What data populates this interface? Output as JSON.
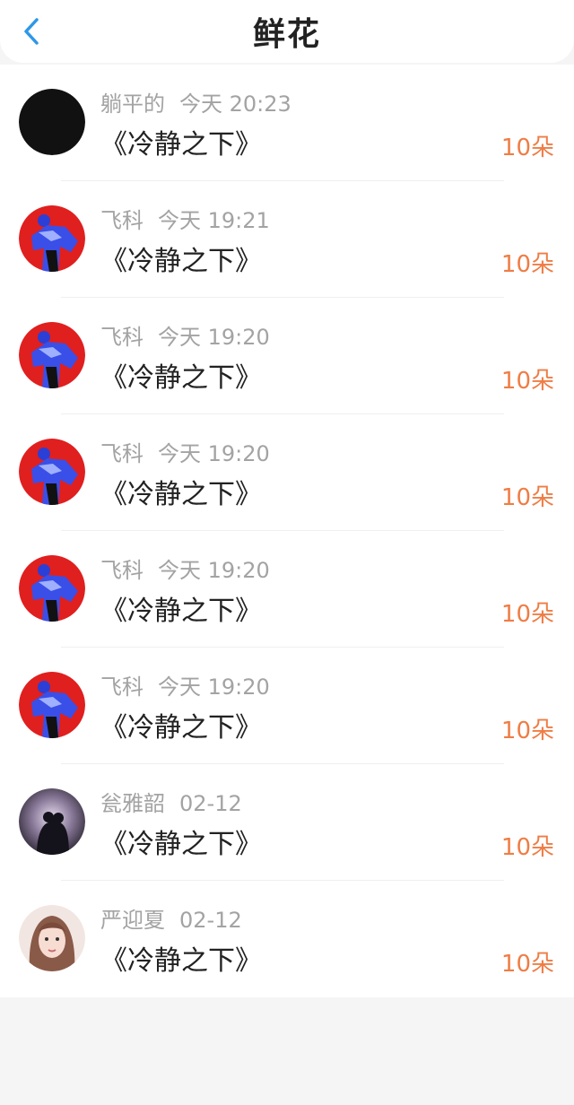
{
  "header": {
    "title": "鲜花",
    "back_icon": "chevron-left-icon",
    "accent": "#2e97e8"
  },
  "count_color": "#ef7d45",
  "items": [
    {
      "user": "躺平的",
      "time": "今天 20:23",
      "book": "《冷静之下》",
      "count": "10朵",
      "avatar": "black-circle-avatar"
    },
    {
      "user": "飞科",
      "time": "今天 19:21",
      "book": "《冷静之下》",
      "count": "10朵",
      "avatar": "red-blue-figure-avatar"
    },
    {
      "user": "飞科",
      "time": "今天 19:20",
      "book": "《冷静之下》",
      "count": "10朵",
      "avatar": "red-blue-figure-avatar"
    },
    {
      "user": "飞科",
      "time": "今天 19:20",
      "book": "《冷静之下》",
      "count": "10朵",
      "avatar": "red-blue-figure-avatar"
    },
    {
      "user": "飞科",
      "time": "今天 19:20",
      "book": "《冷静之下》",
      "count": "10朵",
      "avatar": "red-blue-figure-avatar"
    },
    {
      "user": "飞科",
      "time": "今天 19:20",
      "book": "《冷静之下》",
      "count": "10朵",
      "avatar": "red-blue-figure-avatar"
    },
    {
      "user": "瓮雅韶",
      "time": "02-12",
      "book": "《冷静之下》",
      "count": "10朵",
      "avatar": "couple-night-photo-avatar"
    },
    {
      "user": "严迎夏",
      "time": "02-12",
      "book": "《冷静之下》",
      "count": "10朵",
      "avatar": "girl-portrait-avatar"
    }
  ]
}
